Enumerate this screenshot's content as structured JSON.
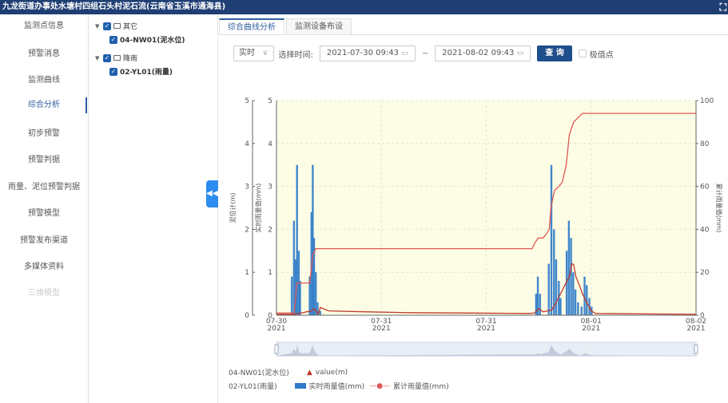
{
  "title": "九龙街道办事处水塘村四组石头村泥石流(云南省玉溪市通海县)",
  "window_control": "⛶",
  "sidebar": {
    "items": [
      {
        "label": "监测点信息"
      },
      {
        "label": "预警消息"
      },
      {
        "label": "监测曲线"
      },
      {
        "label": "综合分析"
      },
      {
        "label": "初步预警"
      },
      {
        "label": "预警判据"
      },
      {
        "label": "雨量、泥位预警判据"
      },
      {
        "label": "预警模型"
      },
      {
        "label": "预警发布渠道"
      },
      {
        "label": "多媒体资料"
      },
      {
        "label": "三维模型"
      }
    ],
    "active": "综合分析"
  },
  "tree": {
    "group1": "其它",
    "group1_child": "04-NW01(泥水位)",
    "group2": "降雨",
    "group2_child": "02-YL01(雨量)"
  },
  "tabs": [
    "综合曲线分析",
    "监测设备布设"
  ],
  "toolbar": {
    "mode": "实时",
    "select_time_label": "选择时间:",
    "start": "2021-07-30 09:43",
    "end": "2021-08-02 09:43",
    "tilde": "~",
    "query": "查 询",
    "extreme_label": "极值点"
  },
  "chart_data": {
    "type": "line",
    "left_axis_outer": {
      "label": "泥位计(m)",
      "ylim": [
        0,
        5
      ],
      "ticks": [
        "0",
        "1",
        "2",
        "3",
        "4",
        "5"
      ]
    },
    "left_axis_inner": {
      "label": "实时雨量值(mm)",
      "ylim": [
        0,
        5
      ],
      "ticks": [
        "0",
        "1",
        "2",
        "3",
        "4",
        "5"
      ]
    },
    "right_axis": {
      "label": "累计雨量值(mm)",
      "ylim": [
        0,
        100
      ],
      "ticks": [
        "0",
        "20",
        "40",
        "60",
        "80",
        "100"
      ]
    },
    "x_ticks": [
      {
        "day": "07-30",
        "year": "2021"
      },
      {
        "day": "07-31",
        "year": "2021"
      },
      {
        "day": "07-31",
        "year": "2021"
      },
      {
        "day": "08-01",
        "year": "2021"
      },
      {
        "day": "08-02",
        "year": "2021"
      }
    ],
    "x_tick_hours": [
      0,
      24,
      48,
      72,
      96
    ],
    "x_range_hours": [
      0,
      96
    ],
    "series": [
      {
        "name": "实时雨量值(mm)",
        "kind": "bar",
        "color": "#2e7ac8",
        "points": [
          [
            3.5,
            0.9
          ],
          [
            4.0,
            2.2
          ],
          [
            4.4,
            1.3
          ],
          [
            4.7,
            3.5
          ],
          [
            5.1,
            1.5
          ],
          [
            5.4,
            0.8
          ],
          [
            7.6,
            0.9
          ],
          [
            8.0,
            2.4
          ],
          [
            8.3,
            3.5
          ],
          [
            8.6,
            1.8
          ],
          [
            9.0,
            1.0
          ],
          [
            9.4,
            0.3
          ],
          [
            10.0,
            0.1
          ],
          [
            59.4,
            0.5
          ],
          [
            59.8,
            0.9
          ],
          [
            60.3,
            0.5
          ],
          [
            62.3,
            1.2
          ],
          [
            62.9,
            3.5
          ],
          [
            63.5,
            2.0
          ],
          [
            64.0,
            1.3
          ],
          [
            64.6,
            0.8
          ],
          [
            65.0,
            0.4
          ],
          [
            66.4,
            1.5
          ],
          [
            66.9,
            2.2
          ],
          [
            67.4,
            1.8
          ],
          [
            67.9,
            1.0
          ],
          [
            68.4,
            0.6
          ],
          [
            69.0,
            0.3
          ],
          [
            69.8,
            0.2
          ],
          [
            70.5,
            0.9
          ],
          [
            71.0,
            0.7
          ],
          [
            71.6,
            0.4
          ],
          [
            72.1,
            0.2
          ]
        ]
      },
      {
        "name": "value(m)",
        "kind": "line",
        "color": "#c0392b",
        "points": [
          [
            0,
            0.02
          ],
          [
            4,
            0.02
          ],
          [
            8,
            0.1
          ],
          [
            8.6,
            0.15
          ],
          [
            9.6,
            0.03
          ],
          [
            10,
            0.18
          ],
          [
            12,
            0.1
          ],
          [
            20,
            0.08
          ],
          [
            30,
            0.06
          ],
          [
            45,
            0.05
          ],
          [
            58,
            0.04
          ],
          [
            59,
            0.05
          ],
          [
            60,
            0.15
          ],
          [
            61,
            0.08
          ],
          [
            62,
            0.1
          ],
          [
            63,
            0.12
          ],
          [
            64,
            0.3
          ],
          [
            65,
            0.5
          ],
          [
            66,
            0.7
          ],
          [
            67,
            0.9
          ],
          [
            67.6,
            1.2
          ],
          [
            68,
            1.18
          ],
          [
            68.5,
            0.9
          ],
          [
            69.3,
            0.7
          ],
          [
            70,
            0.5
          ],
          [
            71,
            0.3
          ],
          [
            72,
            0.1
          ],
          [
            73,
            0.04
          ],
          [
            96,
            0.02
          ]
        ]
      },
      {
        "name": "累计雨量值(mm)",
        "kind": "line",
        "color": "#e05555",
        "axis": "right",
        "points": [
          [
            0,
            1
          ],
          [
            4,
            1
          ],
          [
            4.3,
            6
          ],
          [
            4.6,
            15
          ],
          [
            7.6,
            15
          ],
          [
            7.9,
            20
          ],
          [
            8.3,
            28
          ],
          [
            9,
            31
          ],
          [
            58.5,
            31
          ],
          [
            59.2,
            34
          ],
          [
            59.9,
            36
          ],
          [
            61,
            36
          ],
          [
            61.8,
            38
          ],
          [
            62.4,
            40
          ],
          [
            62.8,
            50
          ],
          [
            63.6,
            58
          ],
          [
            64.6,
            60
          ],
          [
            65.4,
            62
          ],
          [
            66.3,
            70
          ],
          [
            67,
            84
          ],
          [
            68,
            90
          ],
          [
            70,
            94
          ],
          [
            72,
            94
          ],
          [
            96,
            94
          ]
        ]
      }
    ],
    "legend": [
      {
        "station": "04-NW01(泥水位)",
        "entries": [
          "value(m)"
        ]
      },
      {
        "station": "02-YL01(雨量)",
        "entries": [
          "实时雨量值(mm)",
          "累计雨量值(mm)"
        ]
      }
    ]
  }
}
